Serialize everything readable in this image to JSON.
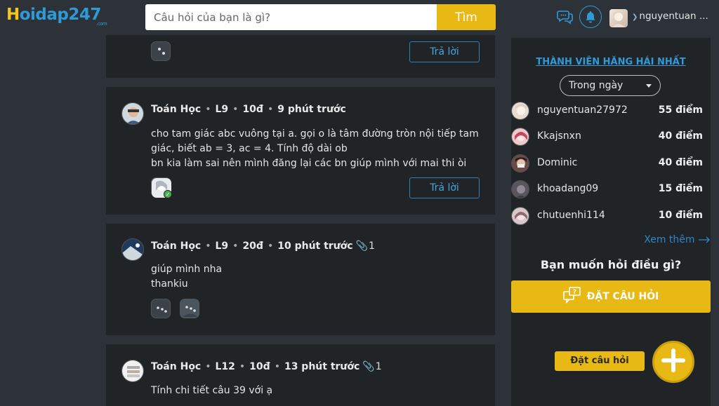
{
  "header": {
    "logo_prefix": "H",
    "logo_rest": "oidap247",
    "logo_suffix": ".com",
    "search_placeholder": "Câu hỏi của bạn là gì?",
    "search_button": "Tìm",
    "username": "nguyentuan ..."
  },
  "feed": {
    "reply_label": "Trả lời",
    "questions": [
      {
        "subject": "Toán Học",
        "grade": "L9",
        "points": "10đ",
        "time": "9 phút trước",
        "text": "cho tam giác abc vuông tại a. gọi o là tâm đường tròn nội tiếp tam giác, biết ab = 3, ac = 4. Tính độ dài ob",
        "text2": "bn kia làm sai nên mình đăng lại các bn giúp mình với mai thi òi"
      },
      {
        "subject": "Toán Học",
        "grade": "L9",
        "points": "20đ",
        "time": "10 phút trước",
        "attachments": "1",
        "text": "giúp mình nha",
        "text2": "thankiu"
      },
      {
        "subject": "Toán Học",
        "grade": "L12",
        "points": "10đ",
        "time": "13 phút trước",
        "attachments": "1",
        "text": "Tính chi tiết câu 39 với ạ"
      }
    ]
  },
  "sidebar": {
    "title": "THÀNH VIÊN HĂNG HÁI NHẤT",
    "period": "Trong ngày",
    "members": [
      {
        "name": "nguyentuan27972",
        "points": "55 điểm"
      },
      {
        "name": "Kkajsnxn",
        "points": "40 điểm"
      },
      {
        "name": "Dominic",
        "points": "40 điểm"
      },
      {
        "name": "khoadang09",
        "points": "15 điểm"
      },
      {
        "name": "chutuenhi114",
        "points": "10 điểm"
      }
    ],
    "see_more": "Xem thêm",
    "ask_title": "Bạn muốn hỏi điều gì?",
    "ask_button": "ĐẶT CÂU HỎI"
  },
  "floating": {
    "label": "Đặt câu hỏi"
  },
  "colors": {
    "accent_yellow": "#e8b815",
    "accent_blue": "#2f9ad6",
    "background": "#2c3237",
    "card": "#202427"
  }
}
